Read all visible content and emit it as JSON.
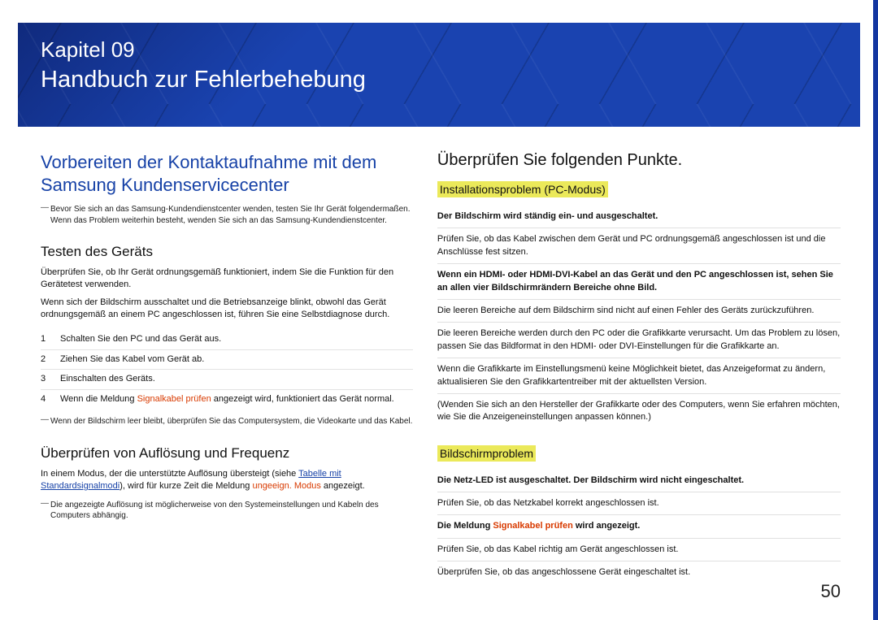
{
  "chapter": {
    "number": "Kapitel 09",
    "title": "Handbuch zur Fehlerbehebung"
  },
  "page_number": "50",
  "left": {
    "main_heading": "Vorbereiten der Kontaktaufnahme mit dem Samsung Kundenservicecenter",
    "main_note": "Bevor Sie sich an das Samsung-Kundendienstcenter wenden, testen Sie Ihr Gerät folgendermaßen. Wenn das Problem weiterhin besteht, wenden Sie sich an das Samsung-Kundendienstcenter.",
    "sec1": {
      "heading": "Testen des Geräts",
      "p1": "Überprüfen Sie, ob Ihr Gerät ordnungsgemäß funktioniert, indem Sie die Funktion für den Gerätetest verwenden.",
      "p2": "Wenn sich der Bildschirm ausschaltet und die Betriebsanzeige blinkt, obwohl das Gerät ordnungsgemäß an einem PC angeschlossen ist, führen Sie eine Selbstdiagnose durch.",
      "steps": [
        "Schalten Sie den PC und das Gerät aus.",
        "Ziehen Sie das Kabel vom Gerät ab.",
        "Einschalten des Geräts."
      ],
      "step4_pre": "Wenn die Meldung ",
      "step4_warn": "Signalkabel prüfen",
      "step4_post": " angezeigt wird, funktioniert das Gerät normal.",
      "note2": "Wenn der Bildschirm leer bleibt, überprüfen Sie das Computersystem, die Videokarte und das Kabel."
    },
    "sec2": {
      "heading": "Überprüfen von Auflösung und Frequenz",
      "p_pre": "In einem Modus, der die unterstützte Auflösung übersteigt (siehe ",
      "p_link": "Tabelle mit Standardsignalmodi",
      "p_mid": "), wird für kurze Zeit die Meldung ",
      "p_warn": "ungeeign. Modus",
      "p_post": " angezeigt.",
      "note": "Die angezeigte Auflösung ist möglicherweise von den Systemeinstellungen und Kabeln des Computers abhängig."
    }
  },
  "right": {
    "main_heading": "Überprüfen Sie folgenden Punkte.",
    "sec1": {
      "heading": "Installationsproblem (PC-Modus)",
      "rows": [
        {
          "bold": true,
          "text": "Der Bildschirm wird ständig ein- und ausgeschaltet."
        },
        {
          "bold": false,
          "text": "Prüfen Sie, ob das Kabel zwischen dem Gerät und PC ordnungsgemäß angeschlossen ist und die Anschlüsse fest sitzen."
        },
        {
          "bold": true,
          "text": "Wenn ein HDMI- oder HDMI-DVI-Kabel an das Gerät und den PC angeschlossen ist, sehen Sie an allen vier Bildschirmrändern Bereiche ohne Bild."
        },
        {
          "bold": false,
          "text": "Die leeren Bereiche auf dem Bildschirm sind nicht auf einen Fehler des Geräts zurückzuführen."
        },
        {
          "bold": false,
          "text": "Die leeren Bereiche werden durch den PC oder die Grafikkarte verursacht. Um das Problem zu lösen, passen Sie das Bildformat in den HDMI- oder DVI-Einstellungen für die Grafikkarte an."
        },
        {
          "bold": false,
          "text": "Wenn die Grafikkarte im Einstellungsmenü keine Möglichkeit bietet, das Anzeigeformat zu ändern, aktualisieren Sie den Grafikkartentreiber mit der aktuellsten Version."
        },
        {
          "bold": false,
          "text": "(Wenden Sie sich an den Hersteller der Grafikkarte oder des Computers, wenn Sie erfahren möchten, wie Sie die Anzeigeneinstellungen anpassen können.)"
        }
      ]
    },
    "sec2": {
      "heading": "Bildschirmproblem",
      "rows": [
        {
          "bold": true,
          "text": "Die Netz-LED ist ausgeschaltet. Der Bildschirm wird nicht eingeschaltet."
        },
        {
          "bold": false,
          "text": "Prüfen Sie, ob das Netzkabel korrekt angeschlossen ist."
        }
      ],
      "msgrow_pre": "Die Meldung ",
      "msgrow_warn": "Signalkabel prüfen",
      "msgrow_post": " wird angezeigt.",
      "rows2": [
        {
          "bold": false,
          "text": "Prüfen Sie, ob das Kabel richtig am Gerät angeschlossen ist."
        },
        {
          "bold": false,
          "text": "Überprüfen Sie, ob das angeschlossene Gerät eingeschaltet ist."
        }
      ]
    }
  }
}
